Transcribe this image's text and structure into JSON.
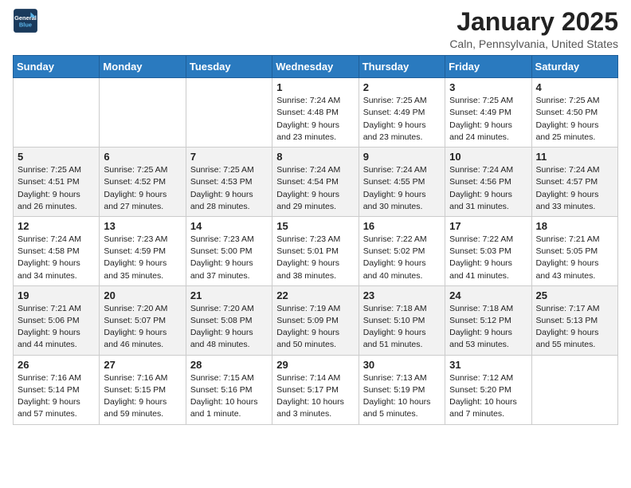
{
  "header": {
    "logo_line1": "General",
    "logo_line2": "Blue",
    "month": "January 2025",
    "location": "Caln, Pennsylvania, United States"
  },
  "weekdays": [
    "Sunday",
    "Monday",
    "Tuesday",
    "Wednesday",
    "Thursday",
    "Friday",
    "Saturday"
  ],
  "weeks": [
    [
      {
        "day": "",
        "info": ""
      },
      {
        "day": "",
        "info": ""
      },
      {
        "day": "",
        "info": ""
      },
      {
        "day": "1",
        "info": "Sunrise: 7:24 AM\nSunset: 4:48 PM\nDaylight: 9 hours and 23 minutes."
      },
      {
        "day": "2",
        "info": "Sunrise: 7:25 AM\nSunset: 4:49 PM\nDaylight: 9 hours and 23 minutes."
      },
      {
        "day": "3",
        "info": "Sunrise: 7:25 AM\nSunset: 4:49 PM\nDaylight: 9 hours and 24 minutes."
      },
      {
        "day": "4",
        "info": "Sunrise: 7:25 AM\nSunset: 4:50 PM\nDaylight: 9 hours and 25 minutes."
      }
    ],
    [
      {
        "day": "5",
        "info": "Sunrise: 7:25 AM\nSunset: 4:51 PM\nDaylight: 9 hours and 26 minutes."
      },
      {
        "day": "6",
        "info": "Sunrise: 7:25 AM\nSunset: 4:52 PM\nDaylight: 9 hours and 27 minutes."
      },
      {
        "day": "7",
        "info": "Sunrise: 7:25 AM\nSunset: 4:53 PM\nDaylight: 9 hours and 28 minutes."
      },
      {
        "day": "8",
        "info": "Sunrise: 7:24 AM\nSunset: 4:54 PM\nDaylight: 9 hours and 29 minutes."
      },
      {
        "day": "9",
        "info": "Sunrise: 7:24 AM\nSunset: 4:55 PM\nDaylight: 9 hours and 30 minutes."
      },
      {
        "day": "10",
        "info": "Sunrise: 7:24 AM\nSunset: 4:56 PM\nDaylight: 9 hours and 31 minutes."
      },
      {
        "day": "11",
        "info": "Sunrise: 7:24 AM\nSunset: 4:57 PM\nDaylight: 9 hours and 33 minutes."
      }
    ],
    [
      {
        "day": "12",
        "info": "Sunrise: 7:24 AM\nSunset: 4:58 PM\nDaylight: 9 hours and 34 minutes."
      },
      {
        "day": "13",
        "info": "Sunrise: 7:23 AM\nSunset: 4:59 PM\nDaylight: 9 hours and 35 minutes."
      },
      {
        "day": "14",
        "info": "Sunrise: 7:23 AM\nSunset: 5:00 PM\nDaylight: 9 hours and 37 minutes."
      },
      {
        "day": "15",
        "info": "Sunrise: 7:23 AM\nSunset: 5:01 PM\nDaylight: 9 hours and 38 minutes."
      },
      {
        "day": "16",
        "info": "Sunrise: 7:22 AM\nSunset: 5:02 PM\nDaylight: 9 hours and 40 minutes."
      },
      {
        "day": "17",
        "info": "Sunrise: 7:22 AM\nSunset: 5:03 PM\nDaylight: 9 hours and 41 minutes."
      },
      {
        "day": "18",
        "info": "Sunrise: 7:21 AM\nSunset: 5:05 PM\nDaylight: 9 hours and 43 minutes."
      }
    ],
    [
      {
        "day": "19",
        "info": "Sunrise: 7:21 AM\nSunset: 5:06 PM\nDaylight: 9 hours and 44 minutes."
      },
      {
        "day": "20",
        "info": "Sunrise: 7:20 AM\nSunset: 5:07 PM\nDaylight: 9 hours and 46 minutes."
      },
      {
        "day": "21",
        "info": "Sunrise: 7:20 AM\nSunset: 5:08 PM\nDaylight: 9 hours and 48 minutes."
      },
      {
        "day": "22",
        "info": "Sunrise: 7:19 AM\nSunset: 5:09 PM\nDaylight: 9 hours and 50 minutes."
      },
      {
        "day": "23",
        "info": "Sunrise: 7:18 AM\nSunset: 5:10 PM\nDaylight: 9 hours and 51 minutes."
      },
      {
        "day": "24",
        "info": "Sunrise: 7:18 AM\nSunset: 5:12 PM\nDaylight: 9 hours and 53 minutes."
      },
      {
        "day": "25",
        "info": "Sunrise: 7:17 AM\nSunset: 5:13 PM\nDaylight: 9 hours and 55 minutes."
      }
    ],
    [
      {
        "day": "26",
        "info": "Sunrise: 7:16 AM\nSunset: 5:14 PM\nDaylight: 9 hours and 57 minutes."
      },
      {
        "day": "27",
        "info": "Sunrise: 7:16 AM\nSunset: 5:15 PM\nDaylight: 9 hours and 59 minutes."
      },
      {
        "day": "28",
        "info": "Sunrise: 7:15 AM\nSunset: 5:16 PM\nDaylight: 10 hours and 1 minute."
      },
      {
        "day": "29",
        "info": "Sunrise: 7:14 AM\nSunset: 5:17 PM\nDaylight: 10 hours and 3 minutes."
      },
      {
        "day": "30",
        "info": "Sunrise: 7:13 AM\nSunset: 5:19 PM\nDaylight: 10 hours and 5 minutes."
      },
      {
        "day": "31",
        "info": "Sunrise: 7:12 AM\nSunset: 5:20 PM\nDaylight: 10 hours and 7 minutes."
      },
      {
        "day": "",
        "info": ""
      }
    ]
  ]
}
